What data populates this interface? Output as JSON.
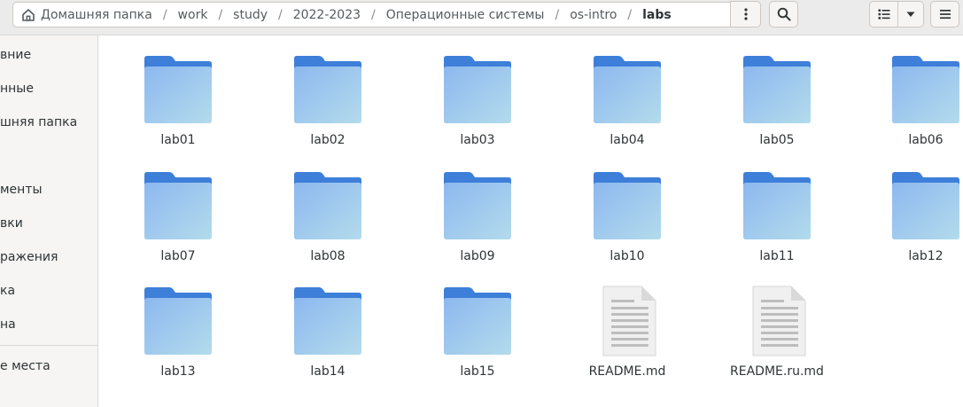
{
  "pathbar": {
    "home": "Домашняя папка",
    "crumbs": [
      "work",
      "study",
      "2022-2023",
      "Операционные системы",
      "os-intro"
    ],
    "current": "labs"
  },
  "sidebar": {
    "items": [
      "вние",
      "нные",
      "шняя папка",
      "",
      "менты",
      "вки",
      "ражения",
      "ка",
      "на"
    ],
    "other": "е места"
  },
  "files": [
    {
      "name": "lab01",
      "kind": "folder"
    },
    {
      "name": "lab02",
      "kind": "folder"
    },
    {
      "name": "lab03",
      "kind": "folder"
    },
    {
      "name": "lab04",
      "kind": "folder"
    },
    {
      "name": "lab05",
      "kind": "folder"
    },
    {
      "name": "lab06",
      "kind": "folder"
    },
    {
      "name": "lab07",
      "kind": "folder"
    },
    {
      "name": "lab08",
      "kind": "folder"
    },
    {
      "name": "lab09",
      "kind": "folder"
    },
    {
      "name": "lab10",
      "kind": "folder"
    },
    {
      "name": "lab11",
      "kind": "folder"
    },
    {
      "name": "lab12",
      "kind": "folder"
    },
    {
      "name": "lab13",
      "kind": "folder"
    },
    {
      "name": "lab14",
      "kind": "folder"
    },
    {
      "name": "lab15",
      "kind": "folder"
    },
    {
      "name": "README.md",
      "kind": "text-file"
    },
    {
      "name": "README.ru.md",
      "kind": "text-file"
    }
  ],
  "colors": {
    "folder_back": "#3d7fd9",
    "folder_front_top": "#8db8ef",
    "folder_front_bottom": "#b3dbec",
    "file_page": "#f0f0f0",
    "file_lines": "#bdbdbd"
  },
  "icons": {
    "home": "home-icon",
    "menu": "vertical-dots-icon",
    "search": "search-icon",
    "view": "list-view-icon",
    "view_dropdown": "chevron-down-icon",
    "hamburger": "hamburger-menu-icon",
    "folder": "folder-icon",
    "text_file": "text-file-icon"
  }
}
